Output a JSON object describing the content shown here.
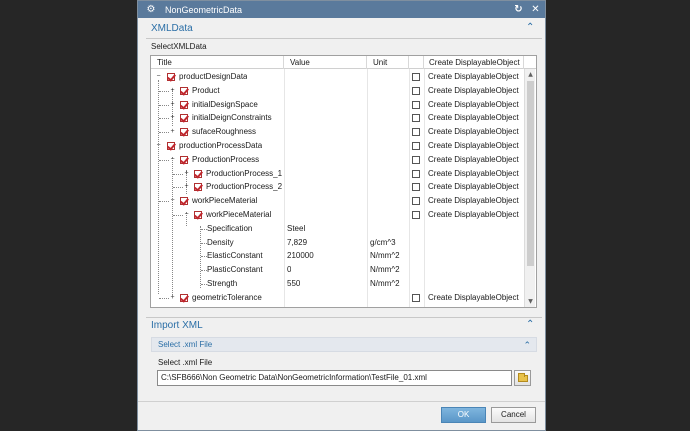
{
  "window": {
    "title": "NonGeometricData",
    "gear_icon": "gear-icon",
    "reset_icon": "refresh-icon",
    "close_icon": "close-icon"
  },
  "xml_section": {
    "title": "XMLData",
    "select_label": "SelectXMLData"
  },
  "tree": {
    "columns": [
      "Title",
      "Value",
      "Unit",
      "",
      "Create DisplayableObject"
    ],
    "rows": [
      {
        "title": "productDesignData",
        "value": "",
        "unit": "",
        "create": "Create DisplayableObject"
      },
      {
        "title": "Product",
        "value": "",
        "unit": "",
        "create": "Create DisplayableObject"
      },
      {
        "title": "initialDesignSpace",
        "value": "",
        "unit": "",
        "create": "Create DisplayableObject"
      },
      {
        "title": "initialDeignConstraints",
        "value": "",
        "unit": "",
        "create": "Create DisplayableObject"
      },
      {
        "title": "sufaceRoughness",
        "value": "",
        "unit": "",
        "create": "Create DisplayableObject"
      },
      {
        "title": "productionProcessData",
        "value": "",
        "unit": "",
        "create": "Create DisplayableObject"
      },
      {
        "title": "ProductionProcess",
        "value": "",
        "unit": "",
        "create": "Create DisplayableObject"
      },
      {
        "title": "ProductionProcess_1",
        "value": "",
        "unit": "",
        "create": "Create DisplayableObject"
      },
      {
        "title": "ProductionProcess_2",
        "value": "",
        "unit": "",
        "create": "Create DisplayableObject"
      },
      {
        "title": "workPieceMaterial",
        "value": "",
        "unit": "",
        "create": "Create DisplayableObject"
      },
      {
        "title": "workPieceMaterial",
        "value": "",
        "unit": "",
        "create": "Create DisplayableObject"
      },
      {
        "title": "Specification",
        "value": "Steel",
        "unit": "",
        "create": ""
      },
      {
        "title": "Density",
        "value": "7,829",
        "unit": "g/cm^3",
        "create": ""
      },
      {
        "title": "ElasticConstant",
        "value": "210000",
        "unit": "N/mm^2",
        "create": ""
      },
      {
        "title": "PlasticConstant",
        "value": "0",
        "unit": "N/mm^2",
        "create": ""
      },
      {
        "title": "Strength",
        "value": "550",
        "unit": "N/mm^2",
        "create": ""
      },
      {
        "title": "geometricTolerance",
        "value": "",
        "unit": "",
        "create": "Create DisplayableObject"
      }
    ]
  },
  "import_section": {
    "title": "Import XML",
    "sub_title": "Select .xml File",
    "file_label": "Select .xml File",
    "file_path": "C:\\SFB666\\Non Geometric Data\\NonGeometricInformation\\TestFile_01.xml",
    "browse_icon": "folder-open-icon"
  },
  "buttons": {
    "ok": "OK",
    "cancel": "Cancel"
  }
}
